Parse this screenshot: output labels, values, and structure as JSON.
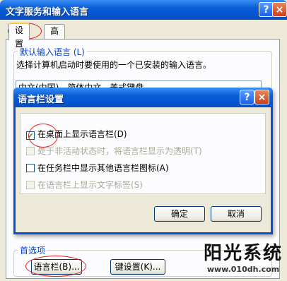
{
  "main_window": {
    "title": "文字服务和输入语言",
    "help_btn": "?",
    "close_btn": "×",
    "tabs": [
      {
        "label": "设置",
        "active": true
      },
      {
        "label": "高级",
        "active": false
      }
    ],
    "default_group_label": "默认输入语言 (L)",
    "default_desc": "选择计算机启动时要使用的一个已安装的输入语言。",
    "combo_value": "中文(中国) - 简体中文 - 美式键盘",
    "pref_label": "首选项",
    "lang_bar_button": "语言栏(B)...",
    "key_settings_button": "键设置(K)..."
  },
  "dialog": {
    "title": "语言栏设置",
    "help_btn": "?",
    "close_btn": "×",
    "options": [
      {
        "label": "在桌面上显示语言栏(D)",
        "checked": true,
        "enabled": true
      },
      {
        "label": "处于非活动状态时，将语言栏显示为透明(T)",
        "checked": false,
        "enabled": false
      },
      {
        "label": "在任务栏中显示其他语言栏图标(A)",
        "checked": false,
        "enabled": true
      },
      {
        "label": "在语言栏上显示文字标签(S)",
        "checked": false,
        "enabled": false
      }
    ],
    "ok_button": "确定",
    "cancel_button": "取消"
  },
  "watermark": {
    "name": "阳光系统",
    "url": "www.010dh.com"
  },
  "colors": {
    "title_blue": "#0a5fd8",
    "close_red": "#c8421e",
    "annotation_red": "#e02020",
    "group_label_blue": "#0046d5"
  }
}
